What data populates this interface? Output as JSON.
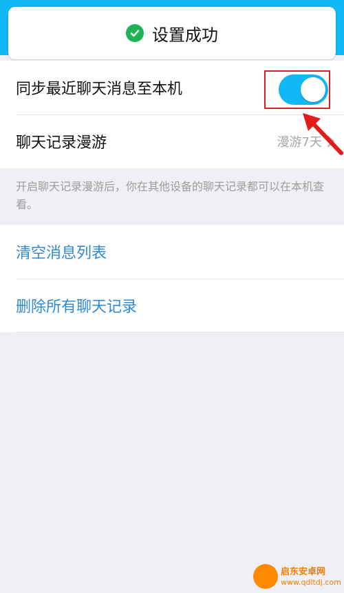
{
  "toast": {
    "icon": "check-circle-icon",
    "text": "设置成功"
  },
  "settings": {
    "sync": {
      "label": "同步最近聊天消息至本机",
      "toggle_on": true
    },
    "roaming": {
      "label": "聊天记录漫游",
      "value": "漫游7天"
    },
    "description": "开启聊天记录漫游后，你在其他设备的聊天记录都可以在本机查看。"
  },
  "actions": {
    "clear": "清空消息列表",
    "delete": "删除所有聊天记录"
  },
  "watermark": {
    "line1": "启东安卓网",
    "line2": "www.qdltdj.com"
  },
  "colors": {
    "accent": "#12b7f5",
    "link": "#2f8ad2",
    "success": "#1eb455",
    "annotation": "#e21b1b"
  }
}
